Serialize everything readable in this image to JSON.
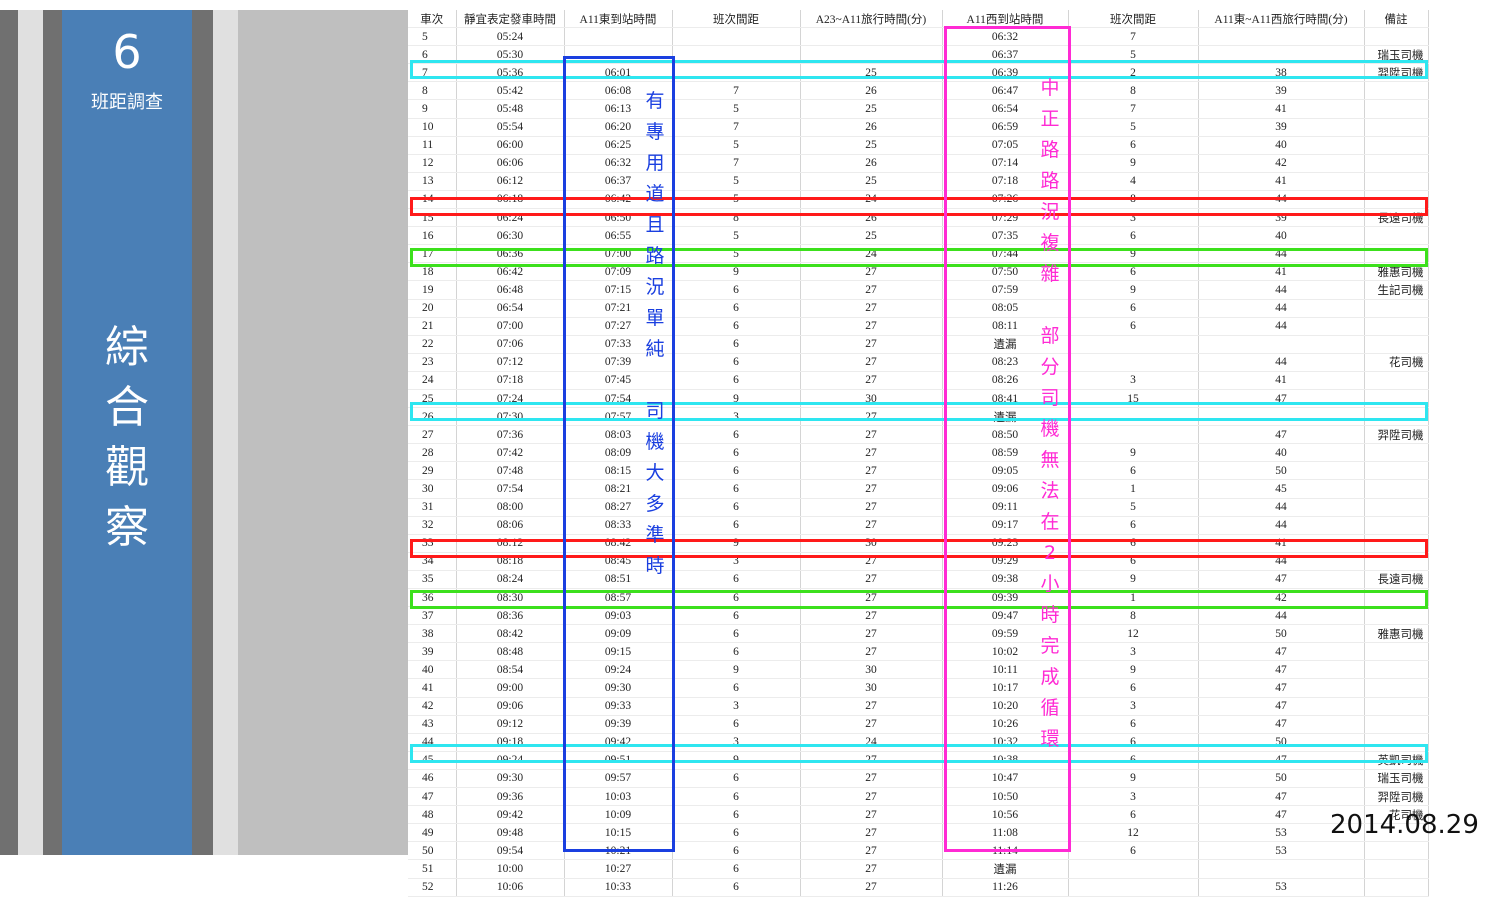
{
  "sidebar": {
    "number": "6",
    "subtitle": "班距調查",
    "title_chars": [
      "綜",
      "合",
      "觀",
      "察"
    ]
  },
  "table": {
    "headers": [
      "車次",
      "靜宜表定發車時間",
      "A11東到站時間",
      "班次間距",
      "A23~A11旅行時間(分)",
      "A11西到站時間",
      "班次間距",
      "A11東~A11西旅行時間(分)",
      "備註"
    ],
    "rows": [
      [
        "5",
        "05:24",
        "",
        "",
        "",
        "06:32",
        "7",
        "",
        ""
      ],
      [
        "6",
        "05:30",
        "",
        "",
        "",
        "06:37",
        "5",
        "",
        "瑞玉司機"
      ],
      [
        "7",
        "05:36",
        "06:01",
        "",
        "25",
        "06:39",
        "2",
        "38",
        "羿陞司機"
      ],
      [
        "8",
        "05:42",
        "06:08",
        "7",
        "26",
        "06:47",
        "8",
        "39",
        ""
      ],
      [
        "9",
        "05:48",
        "06:13",
        "5",
        "25",
        "06:54",
        "7",
        "41",
        ""
      ],
      [
        "10",
        "05:54",
        "06:20",
        "7",
        "26",
        "06:59",
        "5",
        "39",
        ""
      ],
      [
        "11",
        "06:00",
        "06:25",
        "5",
        "25",
        "07:05",
        "6",
        "40",
        ""
      ],
      [
        "12",
        "06:06",
        "06:32",
        "7",
        "26",
        "07:14",
        "9",
        "42",
        ""
      ],
      [
        "13",
        "06:12",
        "06:37",
        "5",
        "25",
        "07:18",
        "4",
        "41",
        ""
      ],
      [
        "14",
        "06:18",
        "06:42",
        "5",
        "24",
        "07:26",
        "8",
        "44",
        ""
      ],
      [
        "15",
        "06:24",
        "06:50",
        "8",
        "26",
        "07:29",
        "3",
        "39",
        "長遠司機"
      ],
      [
        "16",
        "06:30",
        "06:55",
        "5",
        "25",
        "07:35",
        "6",
        "40",
        ""
      ],
      [
        "17",
        "06:36",
        "07:00",
        "5",
        "24",
        "07:44",
        "9",
        "44",
        ""
      ],
      [
        "18",
        "06:42",
        "07:09",
        "9",
        "27",
        "07:50",
        "6",
        "41",
        "雅惠司機"
      ],
      [
        "19",
        "06:48",
        "07:15",
        "6",
        "27",
        "07:59",
        "9",
        "44",
        "生記司機"
      ],
      [
        "20",
        "06:54",
        "07:21",
        "6",
        "27",
        "08:05",
        "6",
        "44",
        ""
      ],
      [
        "21",
        "07:00",
        "07:27",
        "6",
        "27",
        "08:11",
        "6",
        "44",
        ""
      ],
      [
        "22",
        "07:06",
        "07:33",
        "6",
        "27",
        "遺漏",
        "",
        "",
        ""
      ],
      [
        "23",
        "07:12",
        "07:39",
        "6",
        "27",
        "08:23",
        "",
        "44",
        "花司機"
      ],
      [
        "24",
        "07:18",
        "07:45",
        "6",
        "27",
        "08:26",
        "3",
        "41",
        ""
      ],
      [
        "25",
        "07:24",
        "07:54",
        "9",
        "30",
        "08:41",
        "15",
        "47",
        ""
      ],
      [
        "26",
        "07:30",
        "07:57",
        "3",
        "27",
        "遺漏",
        "",
        "",
        ""
      ],
      [
        "27",
        "07:36",
        "08:03",
        "6",
        "27",
        "08:50",
        "",
        "47",
        "羿陞司機"
      ],
      [
        "28",
        "07:42",
        "08:09",
        "6",
        "27",
        "08:59",
        "9",
        "40",
        ""
      ],
      [
        "29",
        "07:48",
        "08:15",
        "6",
        "27",
        "09:05",
        "6",
        "50",
        ""
      ],
      [
        "30",
        "07:54",
        "08:21",
        "6",
        "27",
        "09:06",
        "1",
        "45",
        ""
      ],
      [
        "31",
        "08:00",
        "08:27",
        "6",
        "27",
        "09:11",
        "5",
        "44",
        ""
      ],
      [
        "32",
        "08:06",
        "08:33",
        "6",
        "27",
        "09:17",
        "6",
        "44",
        ""
      ],
      [
        "33",
        "08:12",
        "08:42",
        "9",
        "30",
        "09:23",
        "6",
        "41",
        ""
      ],
      [
        "34",
        "08:18",
        "08:45",
        "3",
        "27",
        "09:29",
        "6",
        "44",
        ""
      ],
      [
        "35",
        "08:24",
        "08:51",
        "6",
        "27",
        "09:38",
        "9",
        "47",
        "長遠司機"
      ],
      [
        "36",
        "08:30",
        "08:57",
        "6",
        "27",
        "09:39",
        "1",
        "42",
        ""
      ],
      [
        "37",
        "08:36",
        "09:03",
        "6",
        "27",
        "09:47",
        "8",
        "44",
        ""
      ],
      [
        "38",
        "08:42",
        "09:09",
        "6",
        "27",
        "09:59",
        "12",
        "50",
        "雅惠司機"
      ],
      [
        "39",
        "08:48",
        "09:15",
        "6",
        "27",
        "10:02",
        "3",
        "47",
        ""
      ],
      [
        "40",
        "08:54",
        "09:24",
        "9",
        "30",
        "10:11",
        "9",
        "47",
        ""
      ],
      [
        "41",
        "09:00",
        "09:30",
        "6",
        "30",
        "10:17",
        "6",
        "47",
        ""
      ],
      [
        "42",
        "09:06",
        "09:33",
        "3",
        "27",
        "10:20",
        "3",
        "47",
        ""
      ],
      [
        "43",
        "09:12",
        "09:39",
        "6",
        "27",
        "10:26",
        "6",
        "47",
        ""
      ],
      [
        "44",
        "09:18",
        "09:42",
        "3",
        "24",
        "10:32",
        "6",
        "50",
        ""
      ],
      [
        "45",
        "09:24",
        "09:51",
        "9",
        "27",
        "10:38",
        "6",
        "47",
        "英凱司機"
      ],
      [
        "46",
        "09:30",
        "09:57",
        "6",
        "27",
        "10:47",
        "9",
        "50",
        "瑞玉司機"
      ],
      [
        "47",
        "09:36",
        "10:03",
        "6",
        "27",
        "10:50",
        "3",
        "47",
        "羿陞司機"
      ],
      [
        "48",
        "09:42",
        "10:09",
        "6",
        "27",
        "10:56",
        "6",
        "47",
        "花司機"
      ],
      [
        "49",
        "09:48",
        "10:15",
        "6",
        "27",
        "11:08",
        "12",
        "53",
        ""
      ],
      [
        "50",
        "09:54",
        "10:21",
        "6",
        "27",
        "11:14",
        "6",
        "53",
        ""
      ],
      [
        "51",
        "10:00",
        "10:27",
        "6",
        "27",
        "遺漏",
        "",
        "",
        ""
      ],
      [
        "52",
        "10:06",
        "10:33",
        "6",
        "27",
        "11:26",
        "",
        "53",
        ""
      ]
    ]
  },
  "annotations": {
    "east_note_chars": [
      "有",
      "專",
      "用",
      "道",
      "且",
      "路",
      "況",
      "單",
      "純",
      "",
      "司",
      "機",
      "大",
      "多",
      "準",
      "時"
    ],
    "west_note_chars": [
      "中",
      "正",
      "路",
      "路",
      "況",
      "複",
      "雜",
      "",
      "部",
      "分",
      "司",
      "機",
      "無",
      "法",
      "在",
      "2",
      "小",
      "時",
      "完",
      "成",
      "循",
      "環"
    ]
  },
  "colors": {
    "sidebar_blue": "#4a7fb6",
    "blue_box": "#1a3fe0",
    "magenta_box": "#ff2ad4",
    "red_box": "#ff1a1a",
    "cyan_box": "#2ee6f0",
    "green_box": "#3ce01c"
  },
  "date": "2014.08.29"
}
